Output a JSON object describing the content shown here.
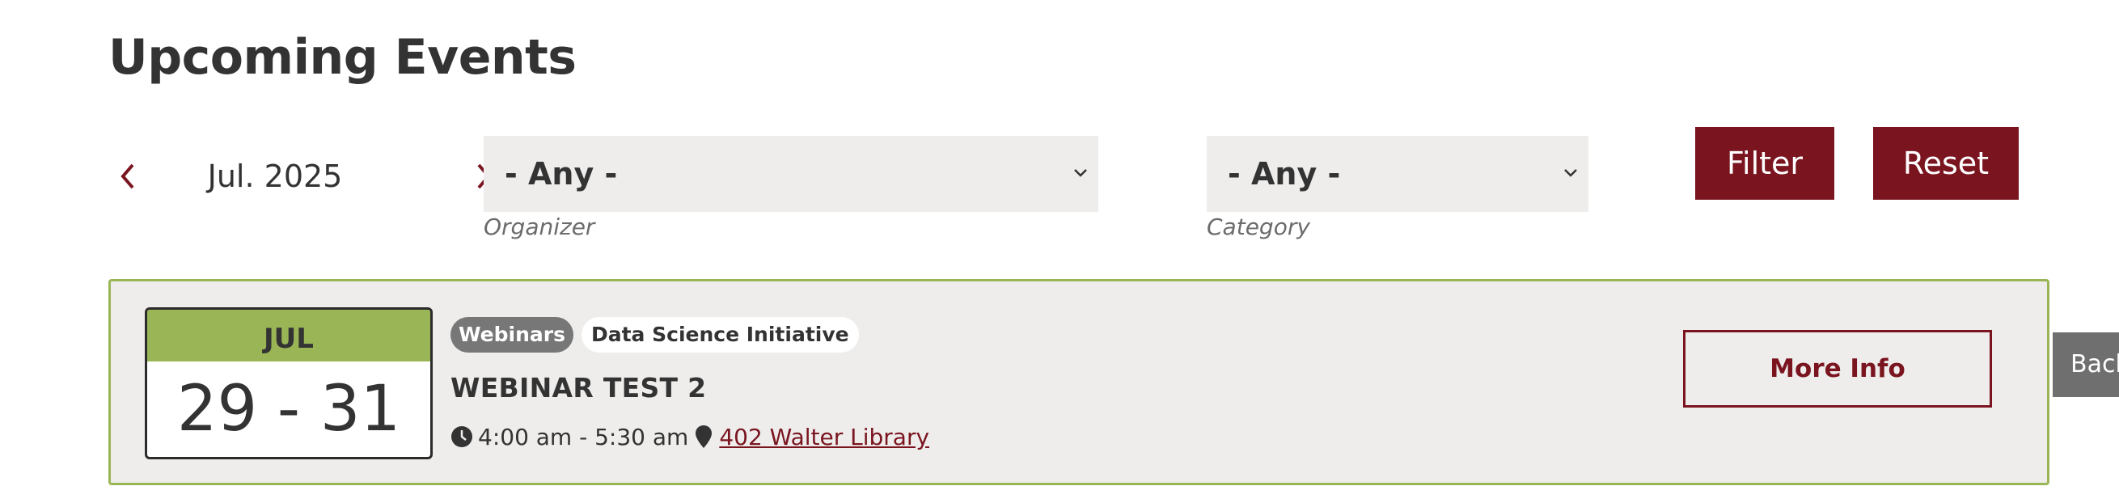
{
  "page": {
    "title": "Upcoming Events"
  },
  "month_nav": {
    "label": "Jul. 2025",
    "prev_icon": "chevron-left-icon",
    "next_icon": "chevron-right-icon"
  },
  "filters": {
    "organizer": {
      "value": "- Any -",
      "help": "Organizer"
    },
    "category": {
      "value": "- Any -",
      "help": "Category"
    },
    "filter_label": "Filter",
    "reset_label": "Reset"
  },
  "event": {
    "month": "JUL",
    "days": "29 - 31",
    "tags": [
      "Webinars",
      "Data Science Initiative"
    ],
    "title": "WEBINAR TEST 2",
    "time": "4:00 am - 5:30 am",
    "location": "402 Walter Library",
    "more_info_label": "More Info"
  },
  "back_tab": {
    "label": "Back"
  },
  "colors": {
    "accent": "#7a1520",
    "green": "#9ab555",
    "panel": "#eeedeb",
    "tag_dark": "#777777"
  }
}
